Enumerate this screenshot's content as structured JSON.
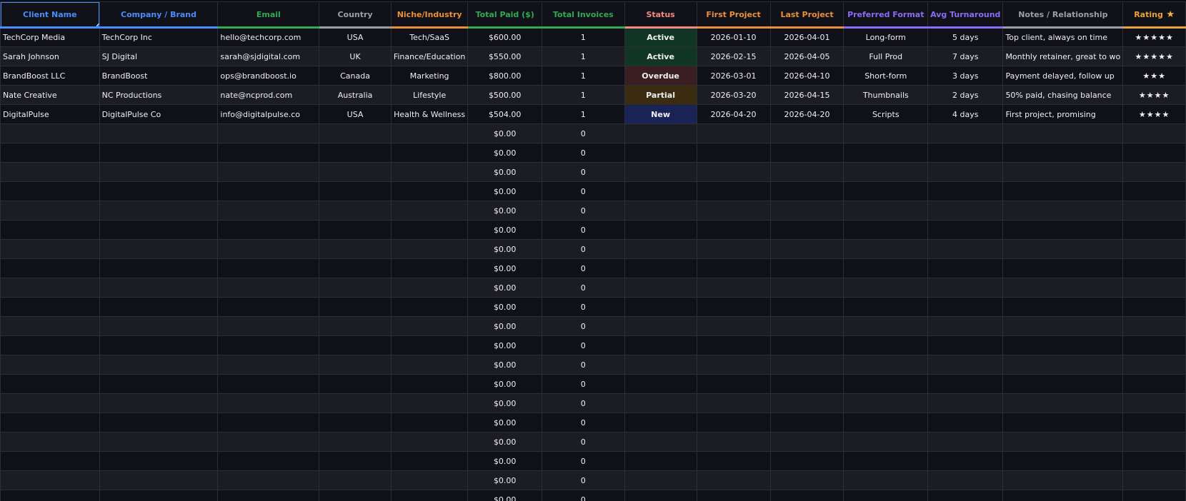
{
  "columns": [
    {
      "label": "Client Name",
      "color": "#4a8df8"
    },
    {
      "label": "Company / Brand",
      "color": "#4a8df8"
    },
    {
      "label": "Email",
      "color": "#34a853"
    },
    {
      "label": "Country",
      "color": "#9aa0a6"
    },
    {
      "label": "Niche/Industry",
      "color": "#e8903d"
    },
    {
      "label": "Total Paid ($)",
      "color": "#34a853"
    },
    {
      "label": "Total Invoices",
      "color": "#34a853"
    },
    {
      "label": "Status",
      "color": "#f28b82"
    },
    {
      "label": "First Project",
      "color": "#e8903d"
    },
    {
      "label": "Last Project",
      "color": "#e8903d"
    },
    {
      "label": "Preferred Format",
      "color": "#8b6cf2"
    },
    {
      "label": "Avg Turnaround",
      "color": "#8b6cf2"
    },
    {
      "label": "Notes / Relationship",
      "color": "#9aa0a6"
    },
    {
      "label": "Rating",
      "color": "#e8a33d",
      "icon": "star-icon"
    }
  ],
  "rows": [
    {
      "client": "TechCorp Media",
      "company": "TechCorp Inc",
      "email": "hello@techcorp.com",
      "country": "USA",
      "niche": "Tech/SaaS",
      "paid": "$600.00",
      "invoices": "1",
      "status": "Active",
      "first": "2026-01-10",
      "last": "2026-04-01",
      "format": "Long-form",
      "turnaround": "5 days",
      "notes": "Top client, always on time",
      "rating": 5
    },
    {
      "client": "Sarah Johnson",
      "company": "SJ Digital",
      "email": "sarah@sjdigital.com",
      "country": "UK",
      "niche": "Finance/Education",
      "paid": "$550.00",
      "invoices": "1",
      "status": "Active",
      "first": "2026-02-15",
      "last": "2026-04-05",
      "format": "Full Prod",
      "turnaround": "7 days",
      "notes": "Monthly retainer, great to wo",
      "rating": 5
    },
    {
      "client": "BrandBoost LLC",
      "company": "BrandBoost",
      "email": "ops@brandboost.io",
      "country": "Canada",
      "niche": "Marketing",
      "paid": "$800.00",
      "invoices": "1",
      "status": "Overdue",
      "first": "2026-03-01",
      "last": "2026-04-10",
      "format": "Short-form",
      "turnaround": "3 days",
      "notes": "Payment delayed, follow up",
      "rating": 3
    },
    {
      "client": "Nate Creative",
      "company": "NC Productions",
      "email": "nate@ncprod.com",
      "country": "Australia",
      "niche": "Lifestyle",
      "paid": "$500.00",
      "invoices": "1",
      "status": "Partial",
      "first": "2026-03-20",
      "last": "2026-04-15",
      "format": "Thumbnails",
      "turnaround": "2 days",
      "notes": "50% paid, chasing balance",
      "rating": 4
    },
    {
      "client": "DigitalPulse",
      "company": "DigitalPulse Co",
      "email": "info@digitalpulse.co",
      "country": "USA",
      "niche": "Health & Wellness",
      "paid": "$504.00",
      "invoices": "1",
      "status": "New",
      "first": "2026-04-20",
      "last": "2026-04-20",
      "format": "Scripts",
      "turnaround": "4 days",
      "notes": "First project, promising",
      "rating": 4
    }
  ],
  "empty_row": {
    "paid": "$0.00",
    "invoices": "0"
  },
  "empty_row_count": 20
}
